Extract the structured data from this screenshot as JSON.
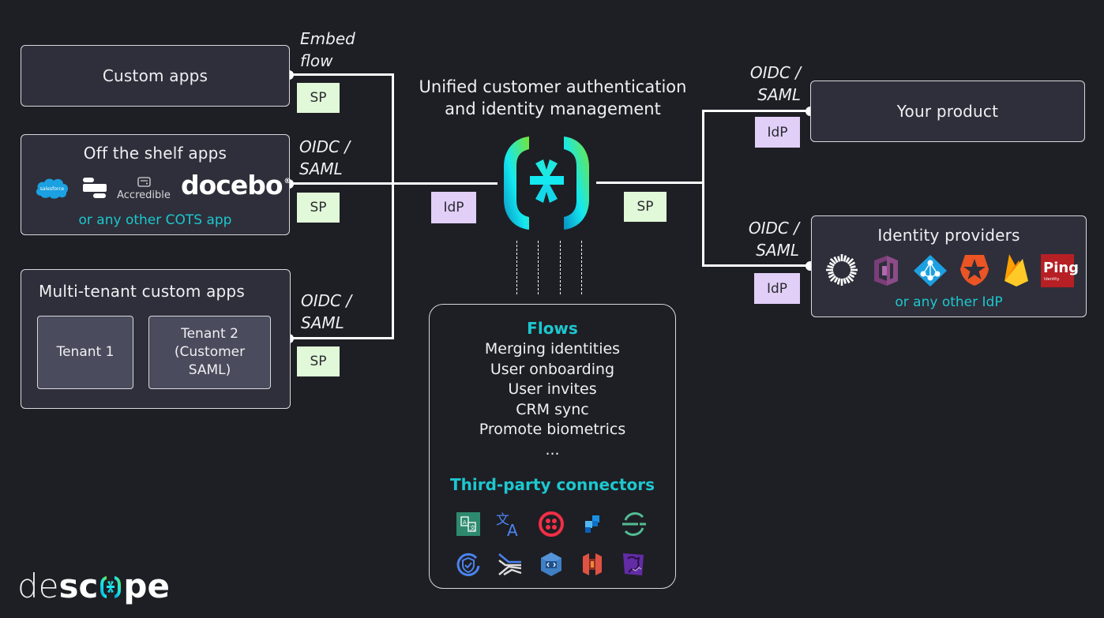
{
  "center": {
    "title_line1": "Unified customer authentication",
    "title_line2": "and identity management",
    "left_tag": "IdP",
    "right_tag": "SP"
  },
  "left": {
    "custom_apps": {
      "title": "Custom apps",
      "protocol_line1": "Embed",
      "protocol_line2": "flow",
      "tag": "SP"
    },
    "off_shelf": {
      "title": "Off the shelf apps",
      "logos": [
        "salesforce",
        "slack-like-app",
        "Accredible",
        "docebo"
      ],
      "salesforce_text": "salesforce",
      "accredible_text": "Accredible",
      "docebo_text": "docebo",
      "footer": "or any other COTS app",
      "protocol_line1": "OIDC /",
      "protocol_line2": "SAML",
      "tag": "SP"
    },
    "multi_tenant": {
      "title": "Multi-tenant custom apps",
      "tenant1": "Tenant 1",
      "tenant2_line1": "Tenant 2",
      "tenant2_line2": "(Customer",
      "tenant2_line3": "SAML)",
      "protocol_line1": "OIDC /",
      "protocol_line2": "SAML",
      "tag": "SP"
    }
  },
  "right": {
    "your_product": {
      "title": "Your product",
      "protocol_line1": "OIDC /",
      "protocol_line2": "SAML",
      "tag": "IdP"
    },
    "identity_providers": {
      "title": "Identity providers",
      "logos": [
        "okta",
        "aws-cognito",
        "azure-ad",
        "auth0",
        "firebase",
        "ping-identity"
      ],
      "ping_text": "Ping",
      "ping_sub": "Identity.",
      "footer": "or any other IdP",
      "protocol_line1": "OIDC /",
      "protocol_line2": "SAML",
      "tag": "IdP"
    }
  },
  "flows": {
    "title": "Flows",
    "items": [
      "Merging identities",
      "User onboarding",
      "User invites",
      "CRM sync",
      "Promote biometrics",
      "..."
    ],
    "connectors_title": "Third-party connectors",
    "connectors_row1": [
      "aws-translate",
      "google-translate",
      "twilio",
      "sumo-like-blocks",
      "segment"
    ],
    "connectors_row2": [
      "fingerprint-shield",
      "lokalise-like",
      "aws-codecommit",
      "aws-s3",
      "datadog"
    ]
  },
  "brand": {
    "logo_thin": "de",
    "logo_bold1": "sc",
    "logo_bold2": "pe",
    "accent_cyan": "#1dc7cf",
    "accent_green": "#6be63a",
    "sp_color": "#e1f8d9",
    "idp_color": "#e1cff8"
  }
}
